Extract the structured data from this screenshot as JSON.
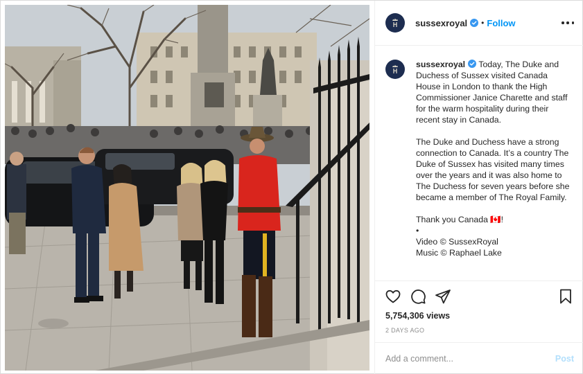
{
  "post": {
    "username": "sussexroyal",
    "header_separator": "•",
    "follow_label": "Follow",
    "caption": {
      "p1": "Today, The Duke and Duchess of Sussex visited Canada House in London to thank the High Commissioner Janice Charette and staff for the warm hospitality during their recent stay in Canada.",
      "p2": "The Duke and Duchess have a strong connection to Canada. It’s a country The Duke of Sussex has visited many times over the years and it was also home to The Duchess for seven years before she became a member of The Royal Family.",
      "p3": "Thank you Canada 🇨🇦!",
      "bullet": "•",
      "credit_video": "Video © SussexRoyal",
      "credit_music": "Music © Raphael Lake"
    },
    "views": "5,754,306 views",
    "time_ago": "2 DAYS AGO",
    "comment": {
      "placeholder": "Add a comment...",
      "post_label": "Post"
    }
  },
  "icons": {
    "avatar": "crown-monogram-icon",
    "verified": "verified-badge-icon",
    "more": "more-options-icon",
    "like": "heart-icon",
    "comment": "comment-bubble-icon",
    "share": "paper-plane-icon",
    "save": "bookmark-icon"
  },
  "colors": {
    "accent": "#0095f6",
    "post_disabled": "#b2dffc",
    "muted": "#8e8e8e",
    "avatar_bg": "#1d2d50",
    "rcmp_red": "#d9251d"
  }
}
